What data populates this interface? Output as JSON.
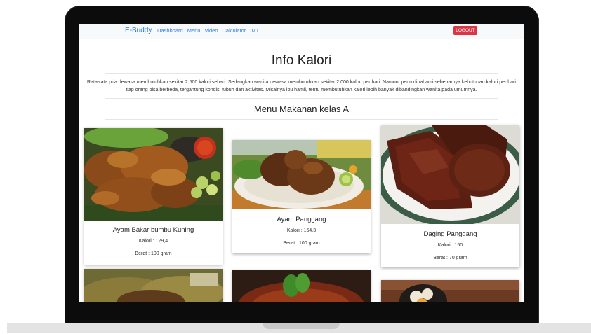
{
  "navbar": {
    "brand": "E-Buddy",
    "links": [
      "Dashboard",
      "Menu",
      "Video",
      "Calculator",
      "IMT"
    ],
    "logout_label": "LOGOUT"
  },
  "page": {
    "title": "Info Kalori",
    "intro": "Rata-rata pria dewasa membutuhkan sekitar 2.500 kalori sehari. Sedangkan wanita dewasa membutuhkan sekitar 2.000 kalori per hari. Namun, perlu dipahami sebenarnya kebutuhan kalori per hari tiap orang bisa berbeda, tergantung kondisi tubuh dan aktivitas. Misalnya ibu hamil, tentu membutuhkan kalori lebih banyak dibandingkan wanita pada umumnya.",
    "section_title": "Menu Makanan kelas A"
  },
  "menu": [
    {
      "name": "Ayam Bakar bumbu Kuning",
      "kalori": "Kalori : 129,4",
      "berat": "Berat : 100 gram"
    },
    {
      "name": "Ayam Panggang",
      "kalori": "Kalori : 164,3",
      "berat": "Berat : 100 gram"
    },
    {
      "name": "Daging Panggang",
      "kalori": "Kalori : 150",
      "berat": "Berat : 70 gram"
    }
  ]
}
